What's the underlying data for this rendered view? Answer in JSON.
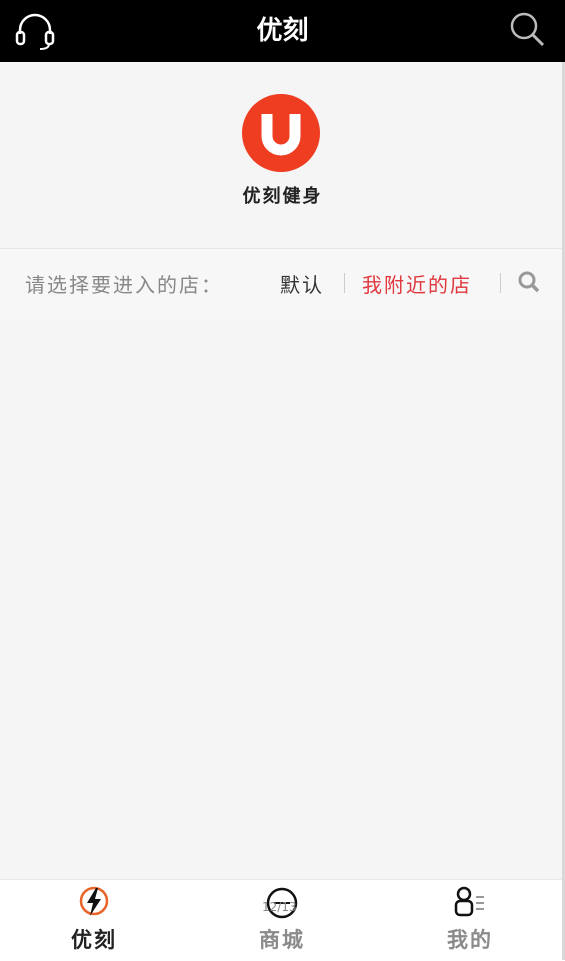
{
  "header": {
    "title": "优刻",
    "left_icon": "headset-icon",
    "right_icon": "search-icon"
  },
  "brand": {
    "logo_letter": "U",
    "name": "优刻健身",
    "accent": "#ef3d22"
  },
  "store_selector": {
    "prompt": "请选择要进入的店：",
    "options": [
      {
        "label": "默认",
        "selected": false
      },
      {
        "label": "我附近的店",
        "selected": true,
        "color": "#e0383e"
      }
    ],
    "search_icon": "search-icon"
  },
  "tabbar": {
    "tabs": [
      {
        "label": "优刻",
        "icon": "lightning-icon",
        "active": true
      },
      {
        "label": "商城",
        "icon": "shop-icon",
        "active": false
      },
      {
        "label": "我的",
        "icon": "profile-icon",
        "active": false
      }
    ],
    "page_indicator": "12/13"
  }
}
